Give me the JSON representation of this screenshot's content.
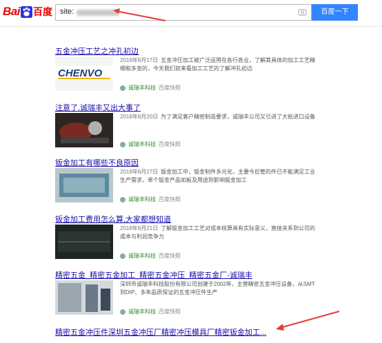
{
  "header": {
    "logo_left": "Bai",
    "logo_right": "百度",
    "search_prefix": "site:",
    "button_label": "百度一下"
  },
  "results": [
    {
      "title": "五金冲压工艺之冲孔初边",
      "date": "2018年8月17日",
      "text": "五金冲压加工被广泛运用在各行各业，了解其具体的加工工艺精细和多变的，今天我们就来看加工工艺的了解冲孔初边",
      "source": "诚瑞丰科技",
      "extra": "百度快照",
      "thumb_color": "#1f3c78"
    },
    {
      "title": "注意了,诚瑞丰又出大事了",
      "date": "2018年8月20日",
      "text": "为了满足客户精密制造要求，诚瑞丰公司又引进了大批进口设备",
      "source": "诚瑞丰科技",
      "extra": "百度快照",
      "thumb_color": "#7a2a22"
    },
    {
      "title": "钣金加工有哪些不良原因",
      "date": "2018年8月27日",
      "text": "钣金加工中，钣金制件多元化，主要今后管的件已不能满足工业生产需求，单个钣金产品如板及用途到影响钣金加工",
      "source": "诚瑞丰科技",
      "extra": "百度快照",
      "thumb_color": "#5c8aa0"
    },
    {
      "title": "钣金加工费用怎么算,大家都想知道",
      "date": "2018年8月21日",
      "text": "了解钣金加工工艺对成本核算具有实际意义，直接关系到公司的成本与利润竞争力",
      "source": "诚瑞丰科技",
      "extra": "百度快照",
      "thumb_color": "#2a3530"
    },
    {
      "title": "精密五金_精密五金加工_精密五金冲压_精密五金厂-诚瑞丰",
      "date": "",
      "text": "深圳市诚瑞丰科技股份有限公司创建于2002年，主营精密五金冲压设备，从SMT到DIP、多年品质保证的五金冲压件生产",
      "source": "诚瑞丰科技",
      "extra": "百度快照",
      "thumb_color": "#9aa6b0"
    },
    {
      "title": "精密五金冲压件深圳五金冲压厂精密冲压模具厂精密钣金加工..."
    }
  ]
}
